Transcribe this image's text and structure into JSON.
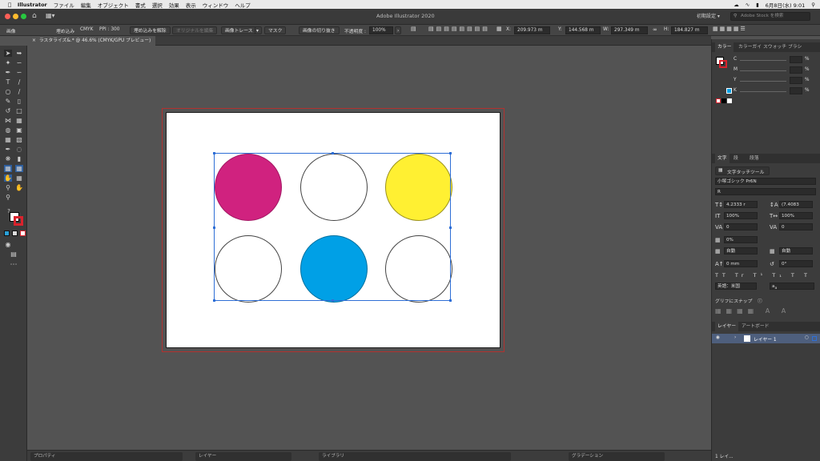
{
  "menubar": {
    "app": "Illustrator",
    "items": [
      "ファイル",
      "編集",
      "オブジェクト",
      "書式",
      "選択",
      "効果",
      "表示",
      "ウィンドウ",
      "ヘルプ"
    ],
    "datetime": "6月8日(水)  9:01"
  },
  "window": {
    "title": "Adobe Illustrator 2020",
    "workspace": "初期設定",
    "search_placeholder": "Adobe Stock を検索"
  },
  "control_bar": {
    "object_type": "画像",
    "embedded": "埋め込み",
    "color_mode": "CMYK",
    "ppi": "PPI : 300",
    "unembed_button": "埋め込みを解除",
    "edit_original_button": "オリジナルを編集",
    "image_trace_button": "画像トレース",
    "mask_button": "マスク",
    "crop_button": "画像の切り抜き",
    "opacity_label": "不透明度 :",
    "opacity_value": "100%",
    "x_label": "X:",
    "x_value": "209.973 m",
    "y_label": "Y:",
    "y_value": "144.568 m",
    "w_label": "W:",
    "w_value": "297.349 m",
    "h_label": "H:",
    "h_value": "184.827 m"
  },
  "document_tab": {
    "label": "ラスタライズ&.* @ 46.6% (CMYK/GPU プレビュー)"
  },
  "canvas": {
    "colors": {
      "magenta": "#d0227f",
      "yellow": "#fff032",
      "cyan": "#00a0e6",
      "empty": "#ffffff",
      "selection": "#2f6fd6",
      "bleed": "#b3312f"
    }
  },
  "color_panel": {
    "tabs": [
      "カラー",
      "カラーガイ",
      "スウォッチ",
      "ブラシ"
    ],
    "channels": [
      {
        "label": "C",
        "unit": "%"
      },
      {
        "label": "M",
        "unit": "%"
      },
      {
        "label": "Y",
        "unit": "%"
      },
      {
        "label": "K",
        "unit": "%"
      }
    ]
  },
  "char_panel": {
    "tabs": [
      "文字",
      "段",
      "段落"
    ],
    "touch_tool": "文字タッチツール",
    "font_family": "小塚ゴシック Pr6N",
    "font_style": "R",
    "font_size": "4.2333 r",
    "leading": "(7.4083",
    "vscale": "100%",
    "hscale": "100%",
    "kerning": "0",
    "tracking": "0",
    "tsume": "0%",
    "aki_left": "自動",
    "aki_right": "自動",
    "baseline": "0 mm",
    "rotation": "0°",
    "language": "英語：米国",
    "glyph_snap": "グリフにスナップ"
  },
  "layers_panel": {
    "tabs": [
      "レイヤー",
      "アートボード"
    ],
    "layer_name": "レイヤー 1",
    "footer": "1 レイ..."
  },
  "bottom": {
    "sections": [
      "プロパティ",
      "レイヤー",
      "ライブラリ",
      "グラデーション"
    ]
  }
}
